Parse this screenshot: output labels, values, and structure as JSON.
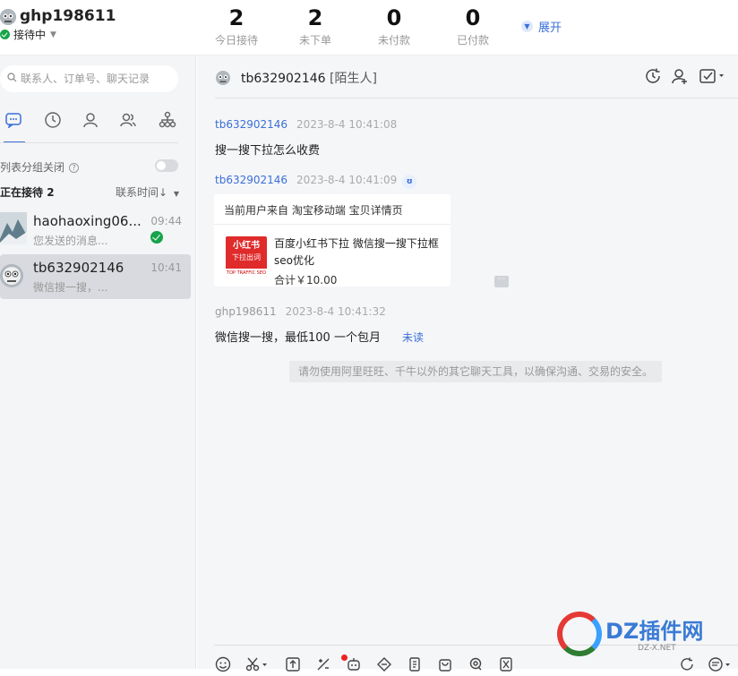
{
  "account": {
    "username": "ghp198611",
    "status": "接待中",
    "avatar_icon": "robot-avatar-icon"
  },
  "stats": [
    {
      "value": "2",
      "label": "今日接待"
    },
    {
      "value": "2",
      "label": "未下单"
    },
    {
      "value": "0",
      "label": "未付款"
    },
    {
      "value": "0",
      "label": "已付款"
    }
  ],
  "expand_label": "展开",
  "sidebar": {
    "search_placeholder": "联系人、订单号、聊天记录",
    "group_toggle_label": "列表分组关闭",
    "group_toggle_on": false,
    "serving_label": "正在接待",
    "serving_count": "2",
    "sort_label": "联系时间↓",
    "conversations": [
      {
        "name": "haohaoxing06...",
        "preview": "您发送的消息...",
        "time": "09:44",
        "replied": true,
        "selected": false
      },
      {
        "name": "tb632902146",
        "preview": "微信搜一搜，...",
        "time": "10:41",
        "replied": false,
        "selected": true
      }
    ]
  },
  "chat": {
    "contact": "tb632902146",
    "contact_tag": "[陌生人]",
    "messages": [
      {
        "sender": "tb632902146",
        "time": "2023-8-4 10:41:08",
        "text": "搜一搜下拉怎么收费"
      },
      {
        "sender": "tb632902146",
        "time": "2023-8-4 10:41:09",
        "card": {
          "source": "当前用户来自 淘宝移动端 宝贝详情页",
          "thumb_line1": "小红书",
          "thumb_line2": "下拉出词",
          "thumb_line3": "TOP TRAFFIC SEO",
          "title": "百度小红书下拉 微信搜一搜下拉框seo优化",
          "price": "合计￥10.00"
        }
      },
      {
        "sender": "ghp198611",
        "time": "2023-8-4 10:41:32",
        "text": "微信搜一搜，最低100 一个包月",
        "status": "未读"
      }
    ],
    "notice": "请勿使用阿里旺旺、千牛以外的其它聊天工具，以确保沟通、交易的安全。"
  },
  "watermark": {
    "brand": "DZ插件网",
    "domain": "DZ-X.NET"
  },
  "colors": {
    "accent": "#3a6fd8",
    "online": "#17a34a",
    "selected_row": "#d8dadf",
    "panel_bg": "#f4f5f7"
  }
}
